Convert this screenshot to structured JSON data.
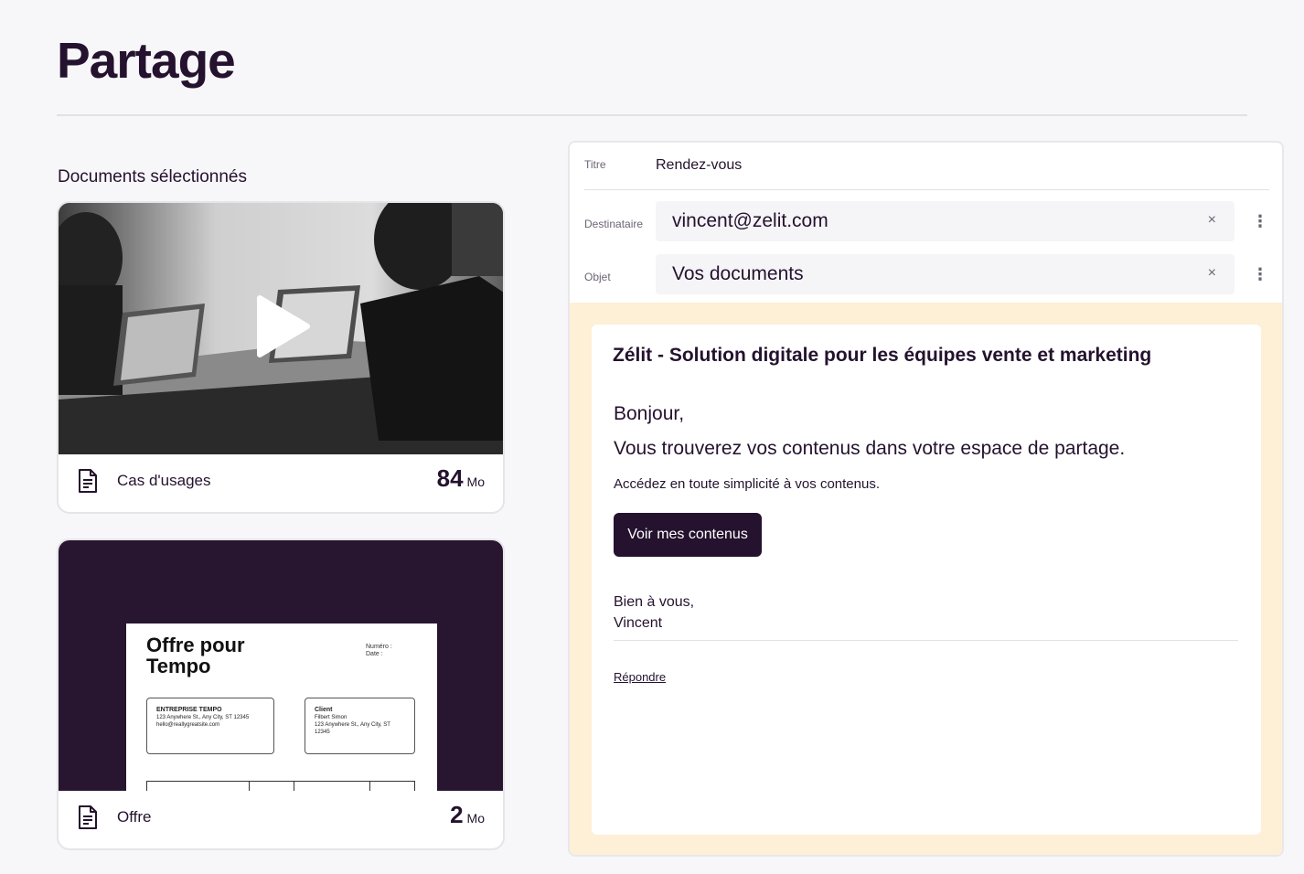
{
  "page": {
    "title": "Partage"
  },
  "documents": {
    "section_label": "Documents sélectionnés",
    "items": [
      {
        "name": "Cas d'usages",
        "size": "84",
        "unit": "Mo",
        "type": "video"
      },
      {
        "name": "Offre",
        "size": "2",
        "unit": "Mo",
        "type": "document"
      }
    ],
    "offer_preview": {
      "title": "Offre pour Tempo",
      "numero_label": "Numéro :",
      "date_label": "Date :",
      "company_name": "ENTREPRISE TEMPO",
      "company_address": "123 Anywhere St., Any City, ST 12345",
      "company_email": "hello@reallygreatsite.com",
      "client_label": "Client",
      "client_name": "Filbert Simon",
      "client_address": "123 Anywhere St., Any City, ST 12345"
    }
  },
  "compose": {
    "title_label": "Titre",
    "title_value": "Rendez-vous",
    "recipient_label": "Destinataire",
    "recipient_value": "vincent@zelit.com",
    "subject_label": "Objet",
    "subject_value": "Vos documents",
    "clear_glyph": "×",
    "more_glyph": "⋮"
  },
  "email": {
    "heading": "Zélit - Solution digitale pour les équipes vente et marketing",
    "greeting": "Bonjour,",
    "lead": "Vous trouverez vos contenus dans votre espace de partage.",
    "subtext": "Accédez en toute simplicité à vos contenus.",
    "cta_label": "Voir mes contenus",
    "signoff_line1": "Bien à vous,",
    "signoff_line2": "Vincent",
    "reply_label": "Répondre"
  },
  "colors": {
    "brand_dark": "#24122e",
    "preview_background": "#fdf0d6",
    "page_background": "#f7f6f9"
  }
}
